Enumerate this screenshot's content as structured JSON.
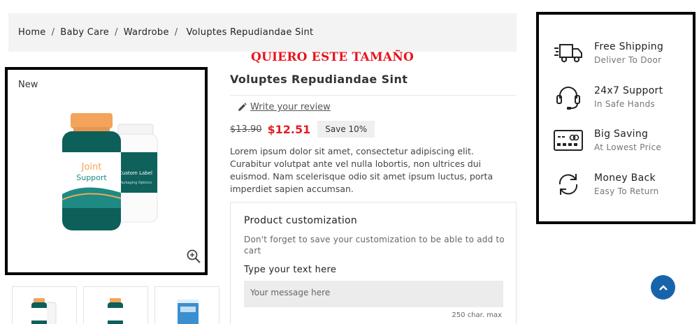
{
  "breadcrumb": [
    "Home",
    "Baby Care",
    "Wardrobe",
    "Voluptes Repudiandae Sint"
  ],
  "annotation": "QUIERO ESTE TAMAÑO",
  "product": {
    "badge": "New",
    "title": "Voluptes Repudiandae Sint",
    "review_label": "Write your review",
    "old_price": "$13.90",
    "price": "$12.51",
    "discount": "Save 10%",
    "description": "Lorem ipsum dolor sit amet, consectetur adipiscing elit. Curabitur volutpat ante vel nulla lobortis, non ultrices dui euismod. Nam scelerisque odio sit amet ipsum luctus, porta imperdiet sapien accumsan.",
    "bottle_front": {
      "line1": "Joint",
      "line2": "Support"
    },
    "bottle_back": {
      "line1": "Custom Label",
      "line2": "Packaging Options"
    }
  },
  "customization": {
    "title": "Product customization",
    "note": "Don't forget to save your customization to be able to add to cart",
    "text_label": "Type your text here",
    "placeholder": "Your message here",
    "max_chars": "250 char. max"
  },
  "features": [
    {
      "title": "Free Shipping",
      "subtitle": "Deliver To Door",
      "icon": "truck-icon"
    },
    {
      "title": "24x7 Support",
      "subtitle": "In Safe Hands",
      "icon": "headset-icon"
    },
    {
      "title": "Big Saving",
      "subtitle": "At Lowest Price",
      "icon": "card-icon"
    },
    {
      "title": "Money Back",
      "subtitle": "Easy To Return",
      "icon": "refresh-icon"
    }
  ],
  "colors": {
    "accent": "#e41e26",
    "scroll_button": "#1864ab",
    "bottle_teal": "#0d5f5a",
    "bottle_cap": "#f3a45a"
  }
}
